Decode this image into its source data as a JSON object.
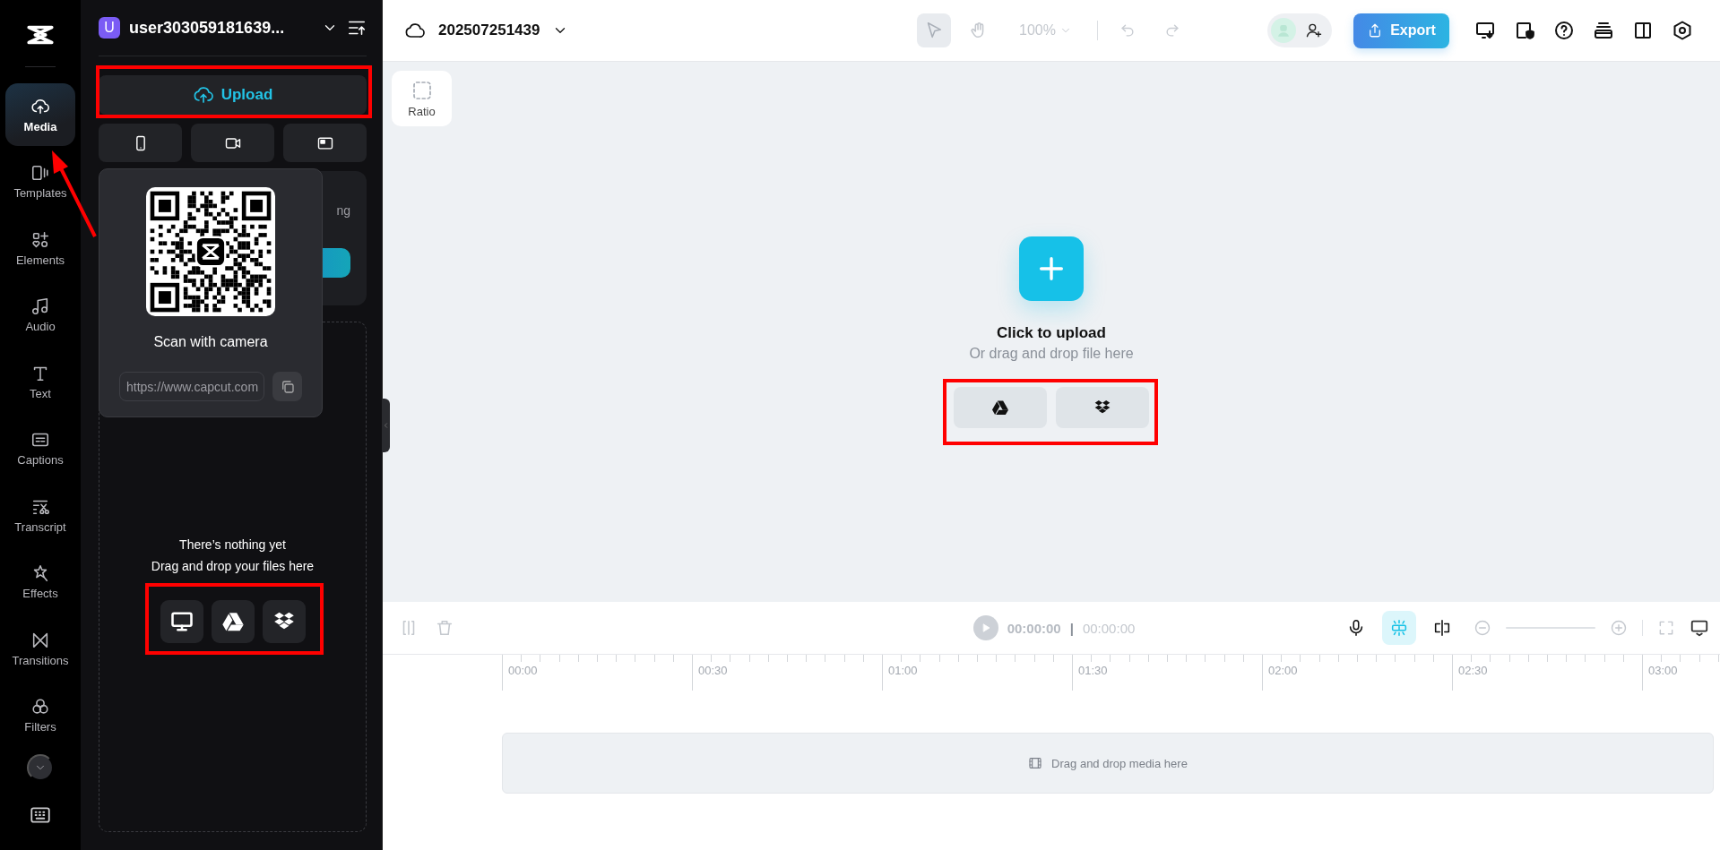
{
  "rail": {
    "items": [
      {
        "label": "Media",
        "selected": true
      },
      {
        "label": "Templates",
        "selected": false
      },
      {
        "label": "Elements",
        "selected": false
      },
      {
        "label": "Audio",
        "selected": false
      },
      {
        "label": "Text",
        "selected": false
      },
      {
        "label": "Captions",
        "selected": false
      },
      {
        "label": "Transcript",
        "selected": false
      },
      {
        "label": "Effects",
        "selected": false
      },
      {
        "label": "Transitions",
        "selected": false
      },
      {
        "label": "Filters",
        "selected": false
      }
    ]
  },
  "panel": {
    "account": {
      "initial": "U",
      "name": "user303059181639..."
    },
    "upload_button": "Upload",
    "hidden_card": {
      "text": "ng"
    },
    "qr_popover": {
      "caption": "Scan with camera",
      "link": "https://www.capcut.com"
    },
    "empty_state": {
      "title": "There’s nothing yet",
      "subtitle": "Drag and drop your files here"
    }
  },
  "topbar": {
    "project_name": "202507251439",
    "tools": [
      {
        "selected": true
      },
      {
        "selected": false
      }
    ],
    "zoom": {
      "value": "100%",
      "disabled": true
    },
    "history": [
      {
        "disabled": true
      },
      {
        "disabled": true
      }
    ],
    "export": "Export"
  },
  "canvas": {
    "ratio": "Ratio",
    "upload_title": "Click to upload",
    "upload_hint": "Or drag and drop file here"
  },
  "timeline": {
    "edit_tools": [
      {
        "disabled": true
      },
      {
        "disabled": true
      }
    ],
    "current_time": "00:00:00",
    "separator": "|",
    "total_time": "00:00:00",
    "tools": [
      {
        "on": false
      },
      {
        "on": true
      },
      {
        "on": false
      }
    ],
    "ruler": [
      "00:00",
      "00:30",
      "01:00",
      "01:30",
      "02:00",
      "02:30",
      "03:00"
    ],
    "track_hint": "Drag and drop media here"
  }
}
